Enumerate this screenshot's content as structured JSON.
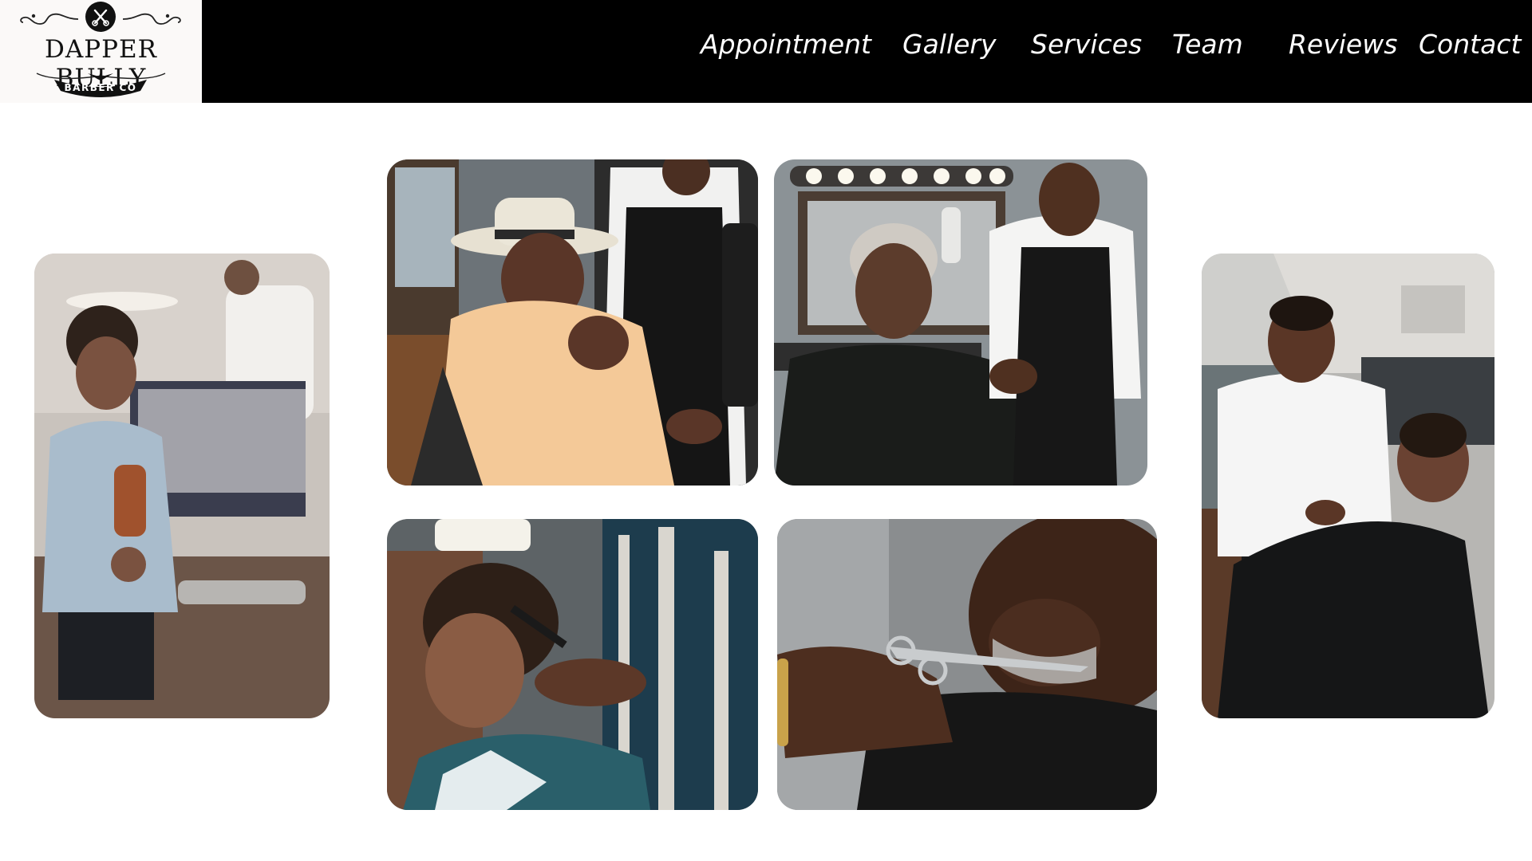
{
  "brand": {
    "name": "DAPPER BULLY",
    "tagline": "BARBER CO"
  },
  "nav": {
    "items": [
      {
        "label": "Appointment"
      },
      {
        "label": "Gallery"
      },
      {
        "label": "Services"
      },
      {
        "label": "Team"
      },
      {
        "label": "Reviews"
      },
      {
        "label": "Contact"
      }
    ]
  },
  "gallery": {
    "photos": [
      {
        "name": "photo-boy-holding-brush"
      },
      {
        "name": "photo-man-in-fedora"
      },
      {
        "name": "photo-barber-spraying-hair"
      },
      {
        "name": "photo-barber-with-boy"
      },
      {
        "name": "photo-comb-haircut"
      },
      {
        "name": "photo-beard-trim"
      }
    ]
  },
  "colors": {
    "header_bg": "#000000",
    "logo_bg": "#fbf9f8",
    "nav_text": "#ffffff",
    "page_bg": "#ffffff"
  }
}
